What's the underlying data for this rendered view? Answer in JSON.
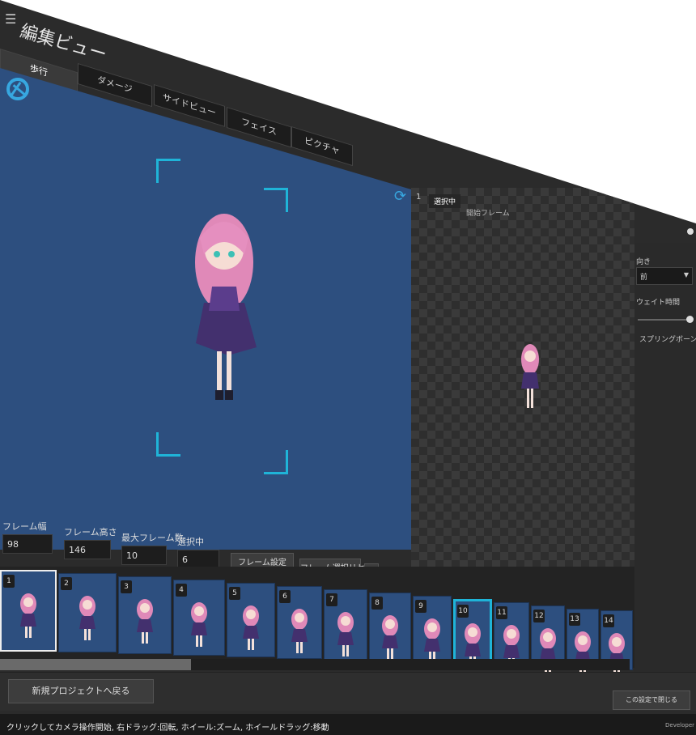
{
  "window": {
    "title": "編集ビュー"
  },
  "tabs": [
    {
      "label": "歩行"
    },
    {
      "label": "ダメージ"
    },
    {
      "label": "サイドビュー"
    },
    {
      "label": "フェイス"
    },
    {
      "label": "ピクチャ"
    }
  ],
  "preview": {
    "index_label": "1",
    "tabs": [
      {
        "label": "選択中"
      },
      {
        "label": "開始フレーム"
      }
    ]
  },
  "side_panel": {
    "direction_label": "向き",
    "direction_value": "前",
    "wait_label": "ウェイト時間",
    "spring_label": "スプリングボーン有効"
  },
  "fields": {
    "frame_width": {
      "label": "フレーム幅",
      "value": "98"
    },
    "frame_height": {
      "label": "フレーム高さ",
      "value": "146"
    },
    "max_frames": {
      "label": "最大フレーム数",
      "value": "10"
    },
    "selected": {
      "label": "選択中",
      "value": "6"
    }
  },
  "buttons": {
    "frame_settings": "フレーム設定",
    "frame_reset": "フレーム選択リセット",
    "back": "新規プロジェクトへ戻る",
    "close_setting": "この設定で閉じる"
  },
  "frames": [
    "1",
    "2",
    "3",
    "4",
    "5",
    "6",
    "7",
    "8",
    "9",
    "10",
    "11",
    "12",
    "13",
    "14"
  ],
  "selected_frame": "10",
  "status": {
    "hint": "クリックしてカメラ操作開始, 右ドラッグ:回転, ホイール:ズーム, ホイールドラッグ:移動",
    "version": "Developer Build"
  },
  "colors": {
    "viewport_bg": "#2d4f7f",
    "accent": "#1fb4d8",
    "panel_bg": "#2b2b2b"
  },
  "icons": {
    "menu": "hamburger-icon",
    "camera": "camera-shutter-icon",
    "refresh": "refresh-icon",
    "play": "play-icon"
  }
}
